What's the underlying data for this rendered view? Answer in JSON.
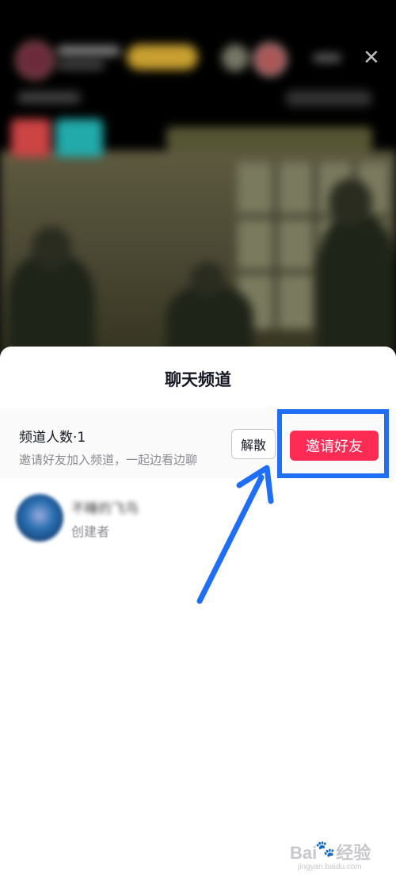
{
  "sheet": {
    "title": "聊天频道",
    "member_count": "频道人数·1",
    "invite_hint": "邀请好友加入频道，一起边看边聊",
    "disband_label": "解散",
    "invite_label": "邀请好友"
  },
  "members": [
    {
      "name": "不睡的飞鸟",
      "role": "创建者"
    }
  ],
  "live": {
    "close_icon": "close-icon"
  },
  "watermark": {
    "brand": "Bai",
    "brand_suffix": "经验",
    "url": "jingyan.baidu.com"
  },
  "colors": {
    "accent": "#fe2c55",
    "annotation": "#1f6ef5"
  }
}
